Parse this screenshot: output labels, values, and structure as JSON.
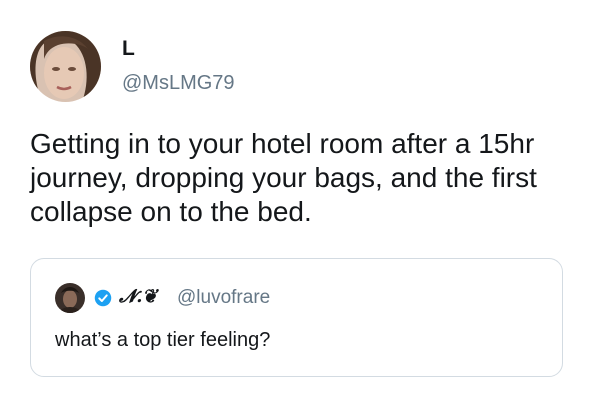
{
  "author": {
    "display_name": "L",
    "handle": "@MsLMG79",
    "avatar_icon": "profile-photo-icon"
  },
  "tweet": {
    "text": "Getting in to your hotel room after a 15hr journey, dropping your bags, and the first collapse on to the bed."
  },
  "quoted_tweet": {
    "display_name": "𝓝.❦",
    "handle": "@luvofrare",
    "verified": true,
    "text": "what’s a top tier feeling?",
    "avatar_icon": "profile-photo-icon"
  },
  "colors": {
    "text": "#14171a",
    "secondary_text": "#657786",
    "verified_blue": "#1da1f2",
    "card_border": "#d3dbe2"
  }
}
